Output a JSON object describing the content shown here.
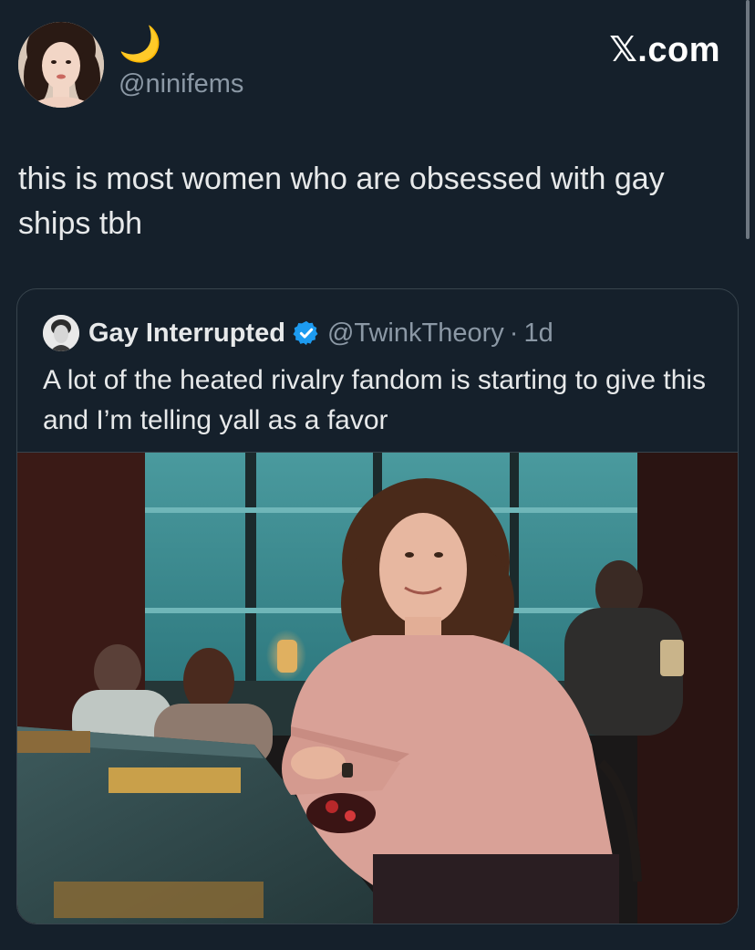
{
  "author": {
    "display_name": "🌙",
    "handle": "@ninifems"
  },
  "brand": {
    "label": "𝕏.com"
  },
  "tweet": {
    "text": "this is most women who are obsessed with gay ships tbh"
  },
  "quote": {
    "name": "Gay Interrupted",
    "handle": "@TwinkTheory",
    "separator": "·",
    "time": "1d",
    "text": "A lot of the heated rivalry fandom is starting to give this and I’m telling yall as a favor",
    "verified_color": "#1d9bf0"
  },
  "colors": {
    "background": "#15202b",
    "secondary_text": "#8b98a5",
    "border": "#38444d"
  }
}
